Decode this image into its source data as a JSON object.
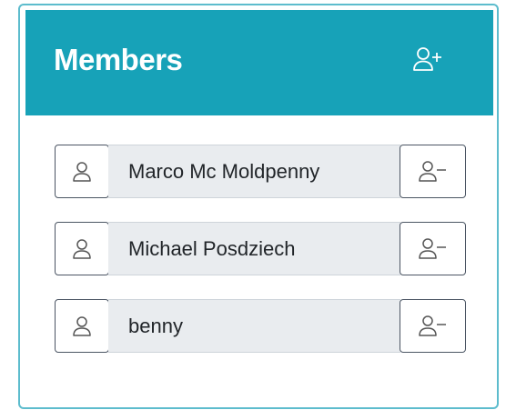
{
  "panel": {
    "title": "Members",
    "add_icon": "person-plus-icon",
    "accent_color": "#17a2b8"
  },
  "members": [
    {
      "name": "Marco Mc Moldpenny",
      "avatar_icon": "person-icon",
      "remove_icon": "person-dash-icon"
    },
    {
      "name": "Michael Posdziech",
      "avatar_icon": "person-icon",
      "remove_icon": "person-dash-icon"
    },
    {
      "name": "benny",
      "avatar_icon": "person-icon",
      "remove_icon": "person-dash-icon"
    }
  ]
}
